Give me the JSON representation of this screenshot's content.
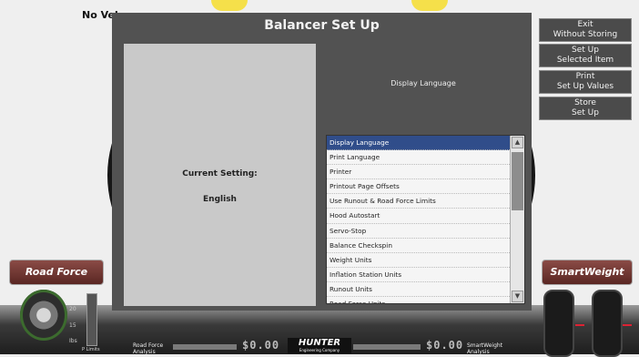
{
  "background": {
    "no_vehicle_text": "No Vel"
  },
  "dialog": {
    "title": "Balancer Set Up",
    "current_setting_label": "Current Setting:",
    "current_setting_value": "English",
    "right_heading": "Display Language",
    "list_items": [
      "Display Language",
      "Print Language",
      "Printer",
      "Printout Page Offsets",
      "Use Runout & Road Force Limits",
      "Hood Autostart",
      "Servo-Stop",
      "Balance Checkspin",
      "Weight Units",
      "Inflation Station Units",
      "Runout Units",
      "Road Force Units"
    ],
    "selected_index": 0
  },
  "side_buttons": [
    {
      "label": "Exit\nWithout Storing"
    },
    {
      "label": "Set Up\nSelected Item"
    },
    {
      "label": "Print\nSet Up Values"
    },
    {
      "label": "Store\nSet Up"
    }
  ],
  "left_panel": {
    "badge": "Road Force",
    "gauge_ticks": [
      "20",
      "15",
      "Ibs"
    ],
    "p_limits": "P Limits",
    "analysis_label_line1": "Road Force",
    "analysis_label_line2": "Analysis"
  },
  "right_panel": {
    "badge": "SmartWeight",
    "analysis_label_line1": "SmartWeight",
    "analysis_label_line2": "Analysis"
  },
  "bottom": {
    "left_readout": "$0.00",
    "right_readout": "$0.00",
    "logo": "HUNTER",
    "logo_sub": "Engineering Company"
  },
  "colors": {
    "dialog_bg": "#525252",
    "selection": "#304d8a",
    "badge": "#6e3530"
  },
  "icons": {
    "scroll_up": "triangle-up-icon",
    "scroll_down": "triangle-down-icon"
  }
}
